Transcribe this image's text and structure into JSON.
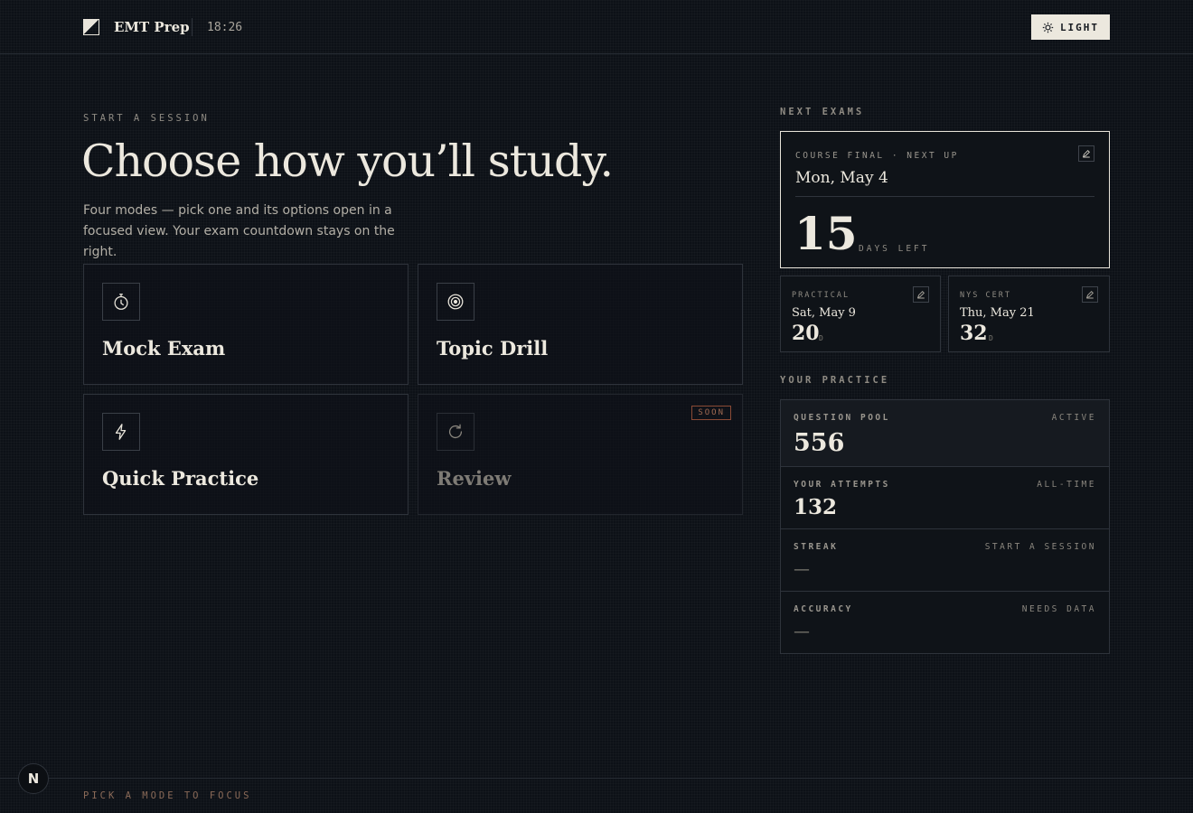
{
  "header": {
    "brand": "EMT Prep",
    "clock": "18:26",
    "theme_toggle_label": "LIGHT",
    "theme_icon": "sun-icon"
  },
  "hero": {
    "eyebrow": "START A SESSION",
    "title": "Choose how you’ll study.",
    "subtitle": "Four modes — pick one and its options open in a focused view. Your exam countdown stays on the right."
  },
  "modes": [
    {
      "label": "Mock Exam",
      "icon": "stopwatch-icon",
      "enabled": true
    },
    {
      "label": "Topic Drill",
      "icon": "target-icon",
      "enabled": true
    },
    {
      "label": "Quick Practice",
      "icon": "lightning-icon",
      "enabled": true
    },
    {
      "label": "Review",
      "icon": "refresh-icon",
      "enabled": false,
      "badge": "SOON"
    }
  ],
  "next_exams": {
    "section_label": "NEXT EXAMS",
    "primary": {
      "kicker": "COURSE FINAL · NEXT UP",
      "date": "Mon, May 4",
      "days": "15",
      "days_unit": "DAYS LEFT"
    },
    "secondary": [
      {
        "kicker": "PRACTICAL",
        "date": "Sat, May 9",
        "days": "20",
        "unit": "D"
      },
      {
        "kicker": "NYS CERT",
        "date": "Thu, May 21",
        "days": "32",
        "unit": "D"
      }
    ]
  },
  "practice": {
    "section_label": "YOUR PRACTICE",
    "stats": [
      {
        "label": "QUESTION POOL",
        "tag": "ACTIVE",
        "value": "556"
      },
      {
        "label": "YOUR ATTEMPTS",
        "tag": "ALL-TIME",
        "value": "132"
      },
      {
        "label": "STREAK",
        "tag": "START A SESSION",
        "value": "—"
      },
      {
        "label": "ACCURACY",
        "tag": "NEEDS DATA",
        "value": "—"
      }
    ]
  },
  "footer": {
    "hint": "PICK A MODE TO FOCUS",
    "badge": "N"
  },
  "colors": {
    "background": "#0d1117",
    "text": "#ece8de",
    "muted": "#8f8b83",
    "accent_badge": "#8a4a35"
  }
}
